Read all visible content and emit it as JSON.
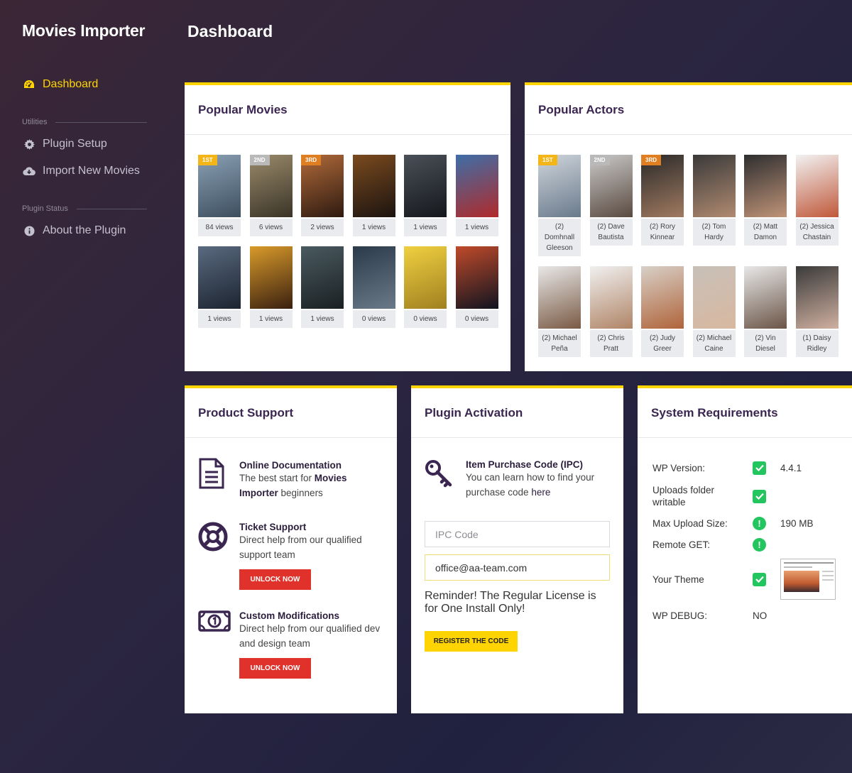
{
  "app": {
    "brand": "Movies Importer",
    "page_title": "Dashboard"
  },
  "sidebar": {
    "items": [
      {
        "label": "Dashboard",
        "icon": "dashboard-gauge-icon",
        "active": true
      }
    ],
    "sections": [
      {
        "title": "Utilities",
        "items": [
          {
            "label": "Plugin Setup",
            "icon": "gear-icon"
          },
          {
            "label": "Import New Movies",
            "icon": "cloud-download-icon"
          }
        ]
      },
      {
        "title": "Plugin Status",
        "items": [
          {
            "label": "About the Plugin",
            "icon": "info-circle-icon"
          }
        ]
      }
    ]
  },
  "popular_movies": {
    "title": "Popular Movies",
    "items": [
      {
        "views": "84 views",
        "rank": "1ST",
        "colors": [
          "#8aa0b4",
          "#3d4f5f"
        ]
      },
      {
        "views": "6 views",
        "rank": "2ND",
        "colors": [
          "#9a8a6a",
          "#3a3428"
        ]
      },
      {
        "views": "2 views",
        "rank": "3RD",
        "colors": [
          "#b06a3a",
          "#2e1a10"
        ]
      },
      {
        "views": "1 views",
        "rank": "",
        "colors": [
          "#7a4a1e",
          "#1c1410"
        ]
      },
      {
        "views": "1 views",
        "rank": "",
        "colors": [
          "#4a5058",
          "#15181c"
        ]
      },
      {
        "views": "1 views",
        "rank": "",
        "colors": [
          "#3e6ea8",
          "#b02a2a"
        ]
      },
      {
        "views": "1 views",
        "rank": "",
        "colors": [
          "#5a6a80",
          "#1c2430"
        ]
      },
      {
        "views": "1 views",
        "rank": "",
        "colors": [
          "#d89a2a",
          "#3a2010"
        ]
      },
      {
        "views": "1 views",
        "rank": "",
        "colors": [
          "#4a5a60",
          "#1a2022"
        ]
      },
      {
        "views": "0 views",
        "rank": "",
        "colors": [
          "#2a3a4a",
          "#6a7a88"
        ]
      },
      {
        "views": "0 views",
        "rank": "",
        "colors": [
          "#f0d040",
          "#a08020"
        ]
      },
      {
        "views": "0 views",
        "rank": "",
        "colors": [
          "#c04a2a",
          "#101420"
        ]
      }
    ]
  },
  "popular_actors": {
    "title": "Popular Actors",
    "items": [
      {
        "name": "(2) Domhnall Gleeson",
        "rank": "1ST",
        "colors": [
          "#cfd5db",
          "#6a7a8c"
        ]
      },
      {
        "name": "(2) Dave Bautista",
        "rank": "2ND",
        "colors": [
          "#c9c9c9",
          "#5a4a40"
        ]
      },
      {
        "name": "(2) Rory Kinnear",
        "rank": "3RD",
        "colors": [
          "#2a2a2a",
          "#a07a60"
        ]
      },
      {
        "name": "(2) Tom Hardy",
        "rank": "",
        "colors": [
          "#3a3a3a",
          "#b08a70"
        ]
      },
      {
        "name": "(2) Matt Damon",
        "rank": "",
        "colors": [
          "#2e2e30",
          "#c09478"
        ]
      },
      {
        "name": "(2) Jessica Chastain",
        "rank": "",
        "colors": [
          "#f2f2f2",
          "#c0583a"
        ]
      },
      {
        "name": "(2) Michael Peña",
        "rank": "",
        "colors": [
          "#e8e8e8",
          "#7a5a44"
        ]
      },
      {
        "name": "(2) Chris Pratt",
        "rank": "",
        "colors": [
          "#f0f0f0",
          "#b08466"
        ]
      },
      {
        "name": "(2) Judy Greer",
        "rank": "",
        "colors": [
          "#d8d0c8",
          "#b0643a"
        ]
      },
      {
        "name": "(2) Michael Caine",
        "rank": "",
        "colors": [
          "#c8c0b8",
          "#d8b8a0"
        ]
      },
      {
        "name": "(2) Vin Diesel",
        "rank": "",
        "colors": [
          "#e8e8e8",
          "#6a5446"
        ]
      },
      {
        "name": "(1) Daisy Ridley",
        "rank": "",
        "colors": [
          "#3a3a3a",
          "#d0b0a0"
        ]
      }
    ]
  },
  "product_support": {
    "title": "Product Support",
    "doc": {
      "title": "Online Documentation",
      "text_a": "The best start for ",
      "text_b": "Movies Importer",
      "text_c": " beginners"
    },
    "ticket": {
      "title": "Ticket Support",
      "text": "Direct help from our qualified support team",
      "button": "UNLOCK NOW"
    },
    "custom": {
      "title": "Custom Modifications",
      "text": "Direct help from our qualified dev and design team",
      "button": "UNLOCK NOW"
    }
  },
  "plugin_activation": {
    "title": "Plugin Activation",
    "ipc_title": "Item Purchase Code (IPC)",
    "ipc_text_a": "You can learn how to find your purchase code ",
    "ipc_link": "here",
    "ipc_placeholder": "IPC Code",
    "email_value": "office@aa-team.com",
    "reminder": "Reminder! The Regular License is for One Install Only!",
    "button": "REGISTER THE CODE"
  },
  "system_requirements": {
    "title": "System Requirements",
    "rows": [
      {
        "label": "WP Version:",
        "status": "check",
        "value": "4.4.1"
      },
      {
        "label": "Uploads folder writable",
        "status": "check",
        "value": ""
      },
      {
        "label": "Max Upload Size:",
        "status": "warn",
        "value": "190 MB"
      },
      {
        "label": "Remote GET:",
        "status": "warn",
        "value": ""
      },
      {
        "label": "Your Theme",
        "status": "check",
        "value": ""
      },
      {
        "label": "WP DEBUG:",
        "status": "",
        "value": "NO"
      }
    ]
  },
  "colors": {
    "accent": "#ffd400",
    "danger": "#e0322b",
    "ok": "#22c55e",
    "heading": "#3a2650"
  }
}
